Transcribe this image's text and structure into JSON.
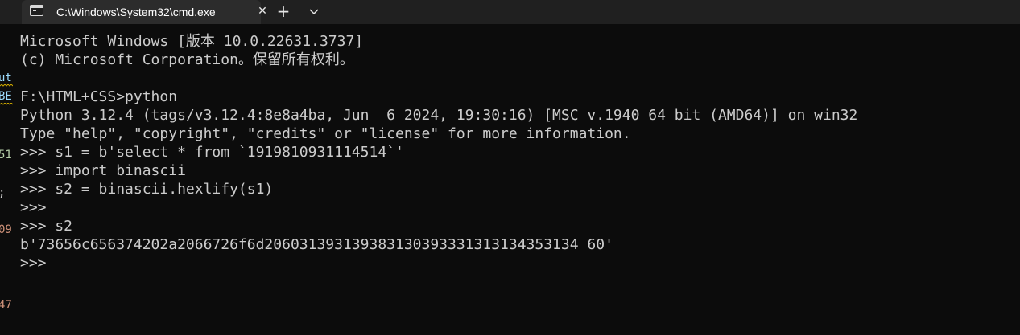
{
  "window": {
    "tab_title": "C:\\Windows\\System32\\cmd.exe",
    "tab_icon": "terminal-icon",
    "close_glyph": "✕",
    "new_tab_glyph": "+",
    "dropdown_icon": "chevron-down-icon"
  },
  "background_window": {
    "fragments": [
      "ut",
      "BE",
      "51",
      ";",
      "09",
      "47"
    ]
  },
  "terminal": {
    "lines": [
      "Microsoft Windows [版本 10.0.22631.3737]",
      "(c) Microsoft Corporation。保留所有权利。",
      "",
      "F:\\HTML+CSS>python",
      "Python 3.12.4 (tags/v3.12.4:8e8a4ba, Jun  6 2024, 19:30:16) [MSC v.1940 64 bit (AMD64)] on win32",
      "Type \"help\", \"copyright\", \"credits\" or \"license\" for more information.",
      ">>> s1 = b'select * from `1919810931114514`'",
      ">>> import binascii",
      ">>> s2 = binascii.hexlify(s1)",
      ">>>",
      ">>> s2",
      "b'73656c656374202a2066726f6d206031393139383130393331313134353134 60'",
      ">>>"
    ]
  },
  "colors": {
    "terminal_bg": "#0c0c0c",
    "terminal_fg": "#cccccc",
    "titlebar_bg": "#202020",
    "tab_bg": "#2c2c2c"
  }
}
